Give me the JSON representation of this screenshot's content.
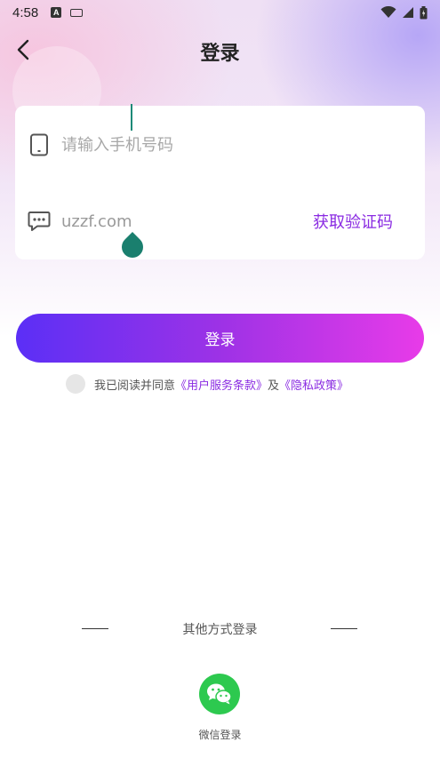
{
  "status_bar": {
    "time": "4:58",
    "notification_icon": "a-icon",
    "keyboard_icon": "keyboard-icon",
    "wifi_icon": "wifi-icon",
    "signal_icon": "signal-icon",
    "battery_icon": "battery-icon"
  },
  "header": {
    "back_icon": "chevron-left-icon",
    "title": "登录"
  },
  "form": {
    "phone_icon": "phone-icon",
    "phone_placeholder": "请输入手机号码",
    "code_icon": "chat-bubble-icon",
    "code_value": "uzzf.com",
    "get_code_label": "获取验证码"
  },
  "login_button": {
    "label": "登录"
  },
  "agreement": {
    "prefix": "我已阅读并同意",
    "terms_link": "《用户服务条款》",
    "conjunction": "及",
    "privacy_link": "《隐私政策》"
  },
  "other_login": {
    "label": "其他方式登录",
    "wechat_icon": "wechat-icon",
    "wechat_label": "微信登录"
  },
  "colors": {
    "accent": "#8a2be2",
    "button_start": "#5b2ff6",
    "button_end": "#e83be8",
    "wechat_green": "#2dc94f",
    "cursor": "#1a7f6e"
  }
}
